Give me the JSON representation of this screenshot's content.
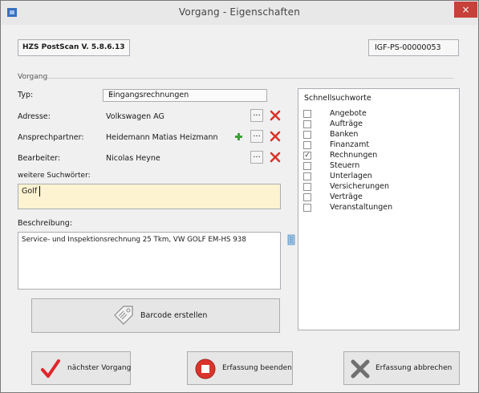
{
  "window": {
    "title": "Vorgang - Eigenschaften",
    "close_glyph": "×"
  },
  "header": {
    "version": "HZS PostScan V. 5.8.6.13",
    "document_id": "IGF-PS-00000053"
  },
  "group": {
    "title": "Vorgang"
  },
  "form": {
    "typ_label": "Typ:",
    "typ_value": "Eingangsrechnungen",
    "adresse_label": "Adresse:",
    "adresse_value": "Volkswagen AG",
    "ansprechpartner_label": "Ansprechpartner:",
    "ansprechpartner_value": "Heidemann Matias Heizmann",
    "bearbeiter_label": "Bearbeiter:",
    "bearbeiter_value": "Nicolas Heyne",
    "dots_label": "...",
    "suchwoerter_label": "weitere Suchwörter:",
    "suchwoerter_value": "Golf",
    "beschreibung_label": "Beschreibung:",
    "beschreibung_value": "Service- und Inspektionsrechnung 25 Tkm, VW GOLF  EM-HS 938"
  },
  "schnellsuchworte": {
    "title": "Schnellsuchworte",
    "items": [
      {
        "label": "Angebote",
        "checked": false
      },
      {
        "label": "Aufträge",
        "checked": false
      },
      {
        "label": "Banken",
        "checked": false
      },
      {
        "label": "Finanzamt",
        "checked": false
      },
      {
        "label": "Rechnungen",
        "checked": true
      },
      {
        "label": "Steuern",
        "checked": false
      },
      {
        "label": "Unterlagen",
        "checked": false
      },
      {
        "label": "Versicherungen",
        "checked": false
      },
      {
        "label": "Verträge",
        "checked": false
      },
      {
        "label": "Veranstaltungen",
        "checked": false
      }
    ]
  },
  "buttons": {
    "barcode": "Barcode erstellen",
    "next": "nächster Vorgang",
    "finish": "Erfassung beenden",
    "cancel": "Erfassung abbrechen"
  },
  "colors": {
    "highlight_field": "#fdf3d0",
    "delete_red": "#d9342b",
    "check_red": "#e0262c",
    "plus_green": "#3aa335"
  }
}
